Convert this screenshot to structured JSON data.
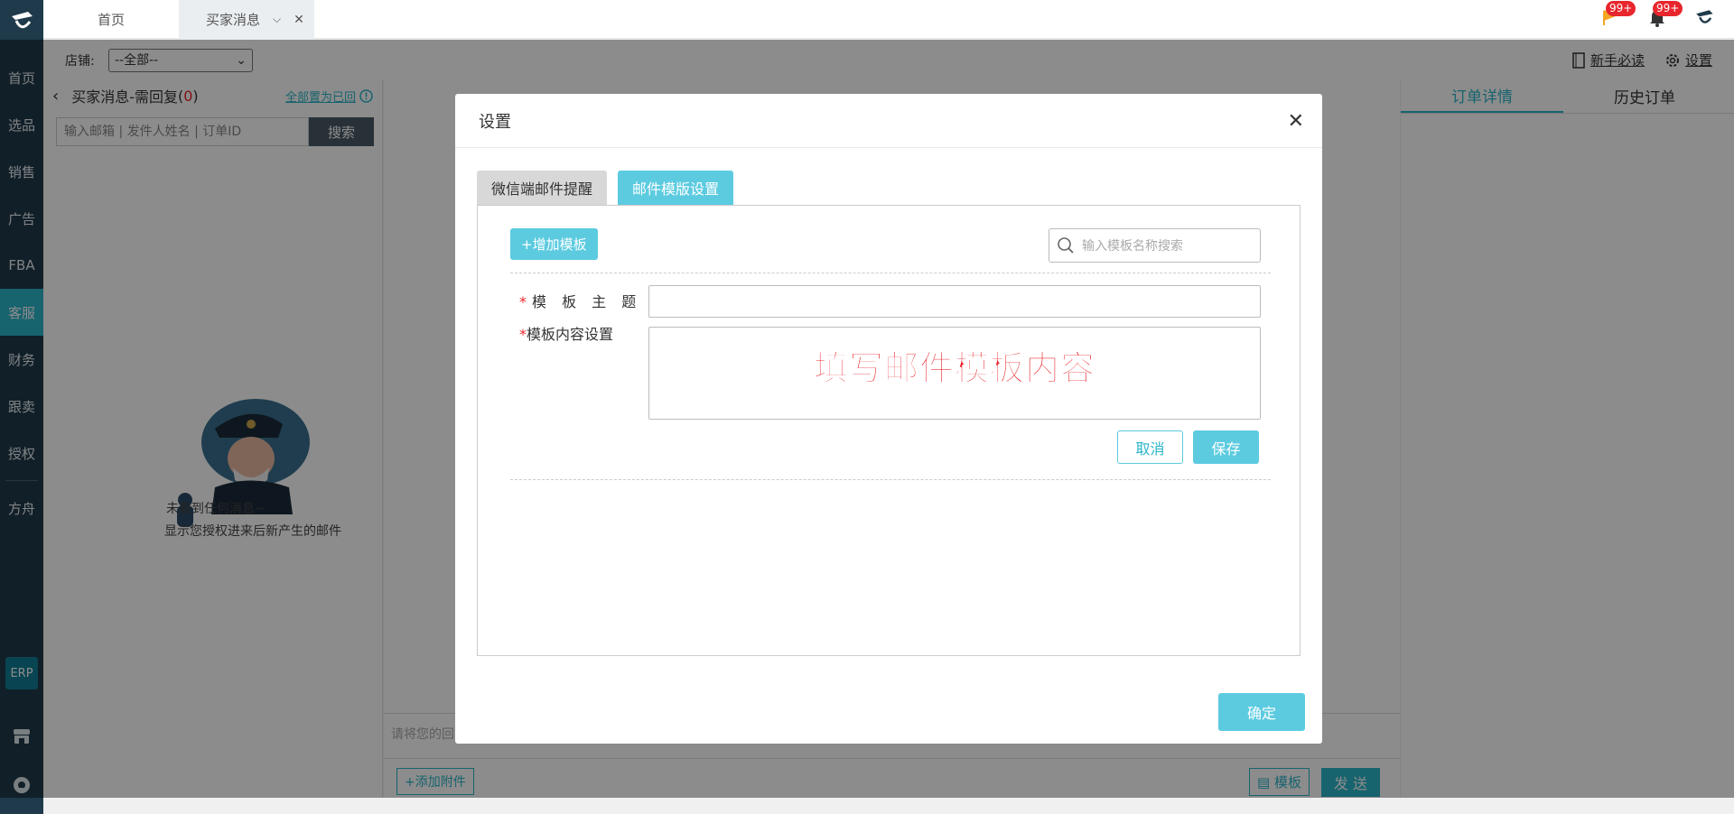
{
  "nav": {
    "items": [
      {
        "label": "首页"
      },
      {
        "label": "选品"
      },
      {
        "label": "销售"
      },
      {
        "label": "广告"
      },
      {
        "label": "FBA"
      },
      {
        "label": "客服"
      },
      {
        "label": "财务"
      },
      {
        "label": "跟卖"
      },
      {
        "label": "授权"
      }
    ],
    "fangzhou": "方舟",
    "erp": "ERP"
  },
  "tabs": {
    "home": "首页",
    "messages": "买家消息"
  },
  "top_right": {
    "flag_badge": "99+",
    "bell_badge": "99+"
  },
  "toolbar": {
    "store_label": "店铺:",
    "store_value": "--全部--",
    "guide": "新手必读",
    "settings": "设置"
  },
  "msgpanel": {
    "title": "买家消息-需回复",
    "count_open": "(",
    "count": "0",
    "count_close": ")",
    "mark_all": "全部置为已回",
    "search_placeholder": "输入邮箱 | 发件人姓名 | 订单ID",
    "search_button": "搜索",
    "empty_line1": "未看到任何消息~",
    "empty_line2": "显示您授权进来后新产生的邮件"
  },
  "chat": {
    "compose_placeholder": "请将您的回",
    "attach": "+添加附件",
    "template": "模板",
    "send": "发 送"
  },
  "rightpanel": {
    "tab_order": "订单详情",
    "tab_history": "历史订单"
  },
  "modal": {
    "title": "设置",
    "tab_wechat": "微信端邮件提醒",
    "tab_template": "邮件模版设置",
    "add_template": "+增加模板",
    "search_placeholder": "输入模板名称搜索",
    "subject_label": "模 板 主 题",
    "content_label": "模板内容设置",
    "required_mark": "*",
    "annotation": "填写邮件模板内容",
    "cancel": "取消",
    "save": "保存",
    "confirm": "确定"
  },
  "colors": {
    "accent": "#5ccbe0",
    "nav_bg": "#1f3a4a",
    "nav_active": "#2bb4c9",
    "badge": "#e8262d",
    "annotation": "#e81c24"
  }
}
